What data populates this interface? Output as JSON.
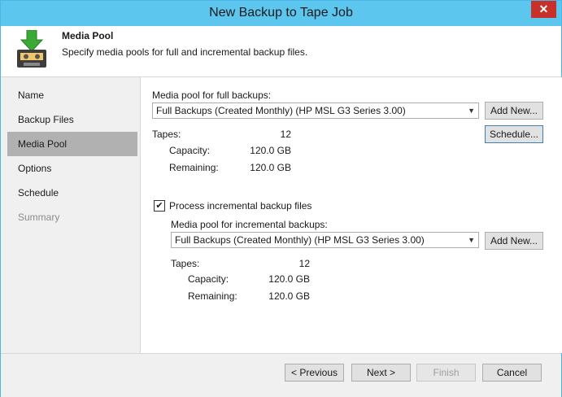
{
  "window": {
    "title": "New Backup to Tape Job",
    "close_glyph": "✕"
  },
  "header": {
    "title": "Media Pool",
    "subtitle": "Specify media pools for full and incremental backup files.",
    "icon": "tape-download-icon"
  },
  "nav": {
    "items": [
      {
        "label": "Name",
        "state": "normal"
      },
      {
        "label": "Backup Files",
        "state": "normal"
      },
      {
        "label": "Media Pool",
        "state": "active"
      },
      {
        "label": "Options",
        "state": "normal"
      },
      {
        "label": "Schedule",
        "state": "normal"
      },
      {
        "label": "Summary",
        "state": "disabled"
      }
    ]
  },
  "full": {
    "label": "Media pool for full backups:",
    "selected": "Full Backups (Created Monthly) (HP MSL G3 Series 3.00)",
    "add_new": "Add New...",
    "schedule": "Schedule...",
    "tapes_label": "Tapes:",
    "tapes_value": "12",
    "capacity_label": "Capacity:",
    "capacity_value": "120.0 GB",
    "remaining_label": "Remaining:",
    "remaining_value": "120.0 GB"
  },
  "incremental": {
    "checkbox_label": "Process incremental backup files",
    "checked": true,
    "label": "Media pool for incremental backups:",
    "selected": "Full Backups (Created Monthly) (HP MSL G3 Series 3.00)",
    "add_new": "Add New...",
    "tapes_label": "Tapes:",
    "tapes_value": "12",
    "capacity_label": "Capacity:",
    "capacity_value": "120.0 GB",
    "remaining_label": "Remaining:",
    "remaining_value": "120.0 GB"
  },
  "footer": {
    "previous": "< Previous",
    "next": "Next >",
    "finish": "Finish",
    "cancel": "Cancel"
  }
}
